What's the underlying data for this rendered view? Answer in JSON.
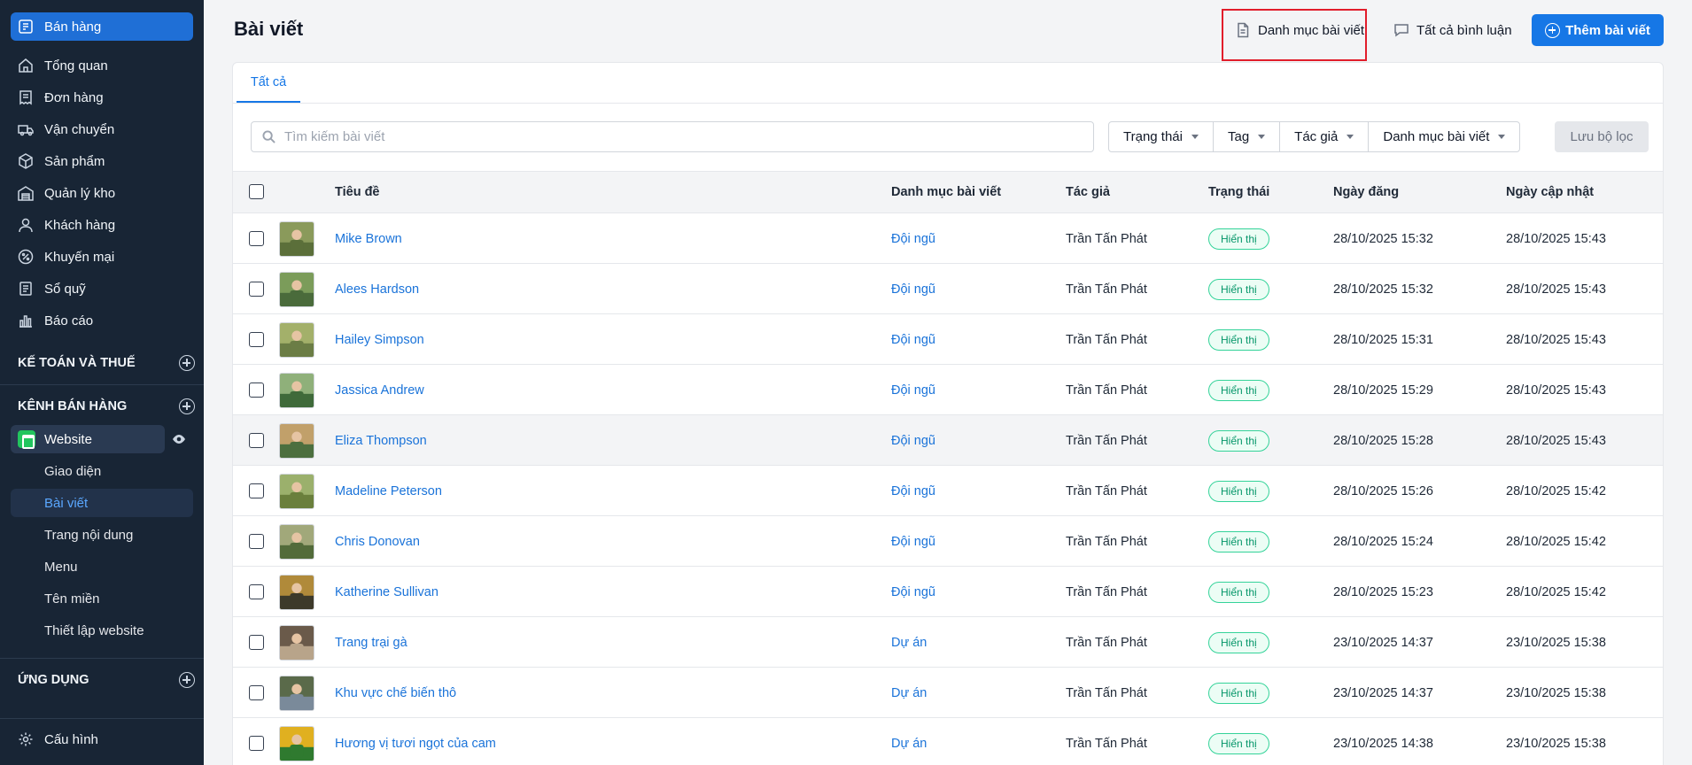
{
  "sidebar": {
    "top": "Bán hàng",
    "items": [
      {
        "label": "Tổng quan",
        "icon": "home-icon"
      },
      {
        "label": "Đơn hàng",
        "icon": "receipt-icon"
      },
      {
        "label": "Vận chuyển",
        "icon": "truck-icon"
      },
      {
        "label": "Sản phẩm",
        "icon": "box-icon"
      },
      {
        "label": "Quản lý kho",
        "icon": "warehouse-icon"
      },
      {
        "label": "Khách hàng",
        "icon": "user-icon"
      },
      {
        "label": "Khuyến mại",
        "icon": "percent-icon"
      },
      {
        "label": "Sổ quỹ",
        "icon": "ledger-icon"
      },
      {
        "label": "Báo cáo",
        "icon": "bar-chart-icon"
      }
    ],
    "section_accounting": "KẾ TOÁN VÀ THUẾ",
    "section_channels": "KÊNH BÁN HÀNG",
    "website": "Website",
    "website_sub": [
      "Giao diện",
      "Bài viết",
      "Trang nội dung",
      "Menu",
      "Tên miền",
      "Thiết lập website"
    ],
    "section_apps": "ỨNG DỤNG",
    "settings": "Cấu hình"
  },
  "header": {
    "title": "Bài viết",
    "categories_btn": "Danh mục bài viết",
    "comments_btn": "Tất cả bình luận",
    "add_btn": "Thêm bài viết"
  },
  "tabs": [
    "Tất cả"
  ],
  "search": {
    "placeholder": "Tìm kiếm bài viết"
  },
  "filters": [
    "Trạng thái",
    "Tag",
    "Tác giả",
    "Danh mục bài viết"
  ],
  "save_filter": "Lưu bộ lọc",
  "table": {
    "columns": [
      "Tiêu đề",
      "Danh mục bài viết",
      "Tác giả",
      "Trạng thái",
      "Ngày đăng",
      "Ngày cập nhật"
    ],
    "rows": [
      {
        "title": "Mike Brown",
        "category": "Đội ngũ",
        "author": "Trần Tấn Phát",
        "status": "Hiển thị",
        "published": "28/10/2025 15:32",
        "updated": "28/10/2025 15:43"
      },
      {
        "title": "Alees Hardson",
        "category": "Đội ngũ",
        "author": "Trần Tấn Phát",
        "status": "Hiển thị",
        "published": "28/10/2025 15:32",
        "updated": "28/10/2025 15:43"
      },
      {
        "title": "Hailey Simpson",
        "category": "Đội ngũ",
        "author": "Trần Tấn Phát",
        "status": "Hiển thị",
        "published": "28/10/2025 15:31",
        "updated": "28/10/2025 15:43"
      },
      {
        "title": "Jassica Andrew",
        "category": "Đội ngũ",
        "author": "Trần Tấn Phát",
        "status": "Hiển thị",
        "published": "28/10/2025 15:29",
        "updated": "28/10/2025 15:43"
      },
      {
        "title": "Eliza Thompson",
        "category": "Đội ngũ",
        "author": "Trần Tấn Phát",
        "status": "Hiển thị",
        "published": "28/10/2025 15:28",
        "updated": "28/10/2025 15:43"
      },
      {
        "title": "Madeline Peterson",
        "category": "Đội ngũ",
        "author": "Trần Tấn Phát",
        "status": "Hiển thị",
        "published": "28/10/2025 15:26",
        "updated": "28/10/2025 15:42"
      },
      {
        "title": "Chris Donovan",
        "category": "Đội ngũ",
        "author": "Trần Tấn Phát",
        "status": "Hiển thị",
        "published": "28/10/2025 15:24",
        "updated": "28/10/2025 15:42"
      },
      {
        "title": "Katherine Sullivan",
        "category": "Đội ngũ",
        "author": "Trần Tấn Phát",
        "status": "Hiển thị",
        "published": "28/10/2025 15:23",
        "updated": "28/10/2025 15:42"
      },
      {
        "title": "Trang trại gà",
        "category": "Dự án",
        "author": "Trần Tấn Phát",
        "status": "Hiển thị",
        "published": "23/10/2025 14:37",
        "updated": "23/10/2025 15:38"
      },
      {
        "title": "Khu vực chế biến thô",
        "category": "Dự án",
        "author": "Trần Tấn Phát",
        "status": "Hiển thị",
        "published": "23/10/2025 14:37",
        "updated": "23/10/2025 15:38"
      },
      {
        "title": "Hương vị tươi ngọt của cam",
        "category": "Dự án",
        "author": "Trần Tấn Phát",
        "status": "Hiển thị",
        "published": "23/10/2025 14:38",
        "updated": "23/10/2025 15:38"
      }
    ]
  }
}
